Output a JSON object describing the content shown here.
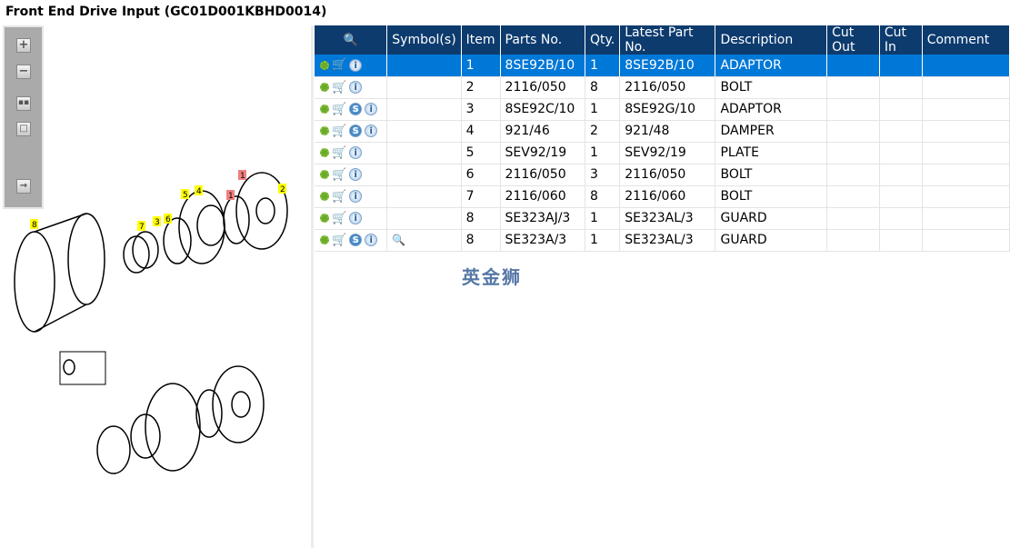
{
  "title": "Front End Drive Input (GC01D001KBHD0014)",
  "watermark": "英金狮",
  "toolbar": [
    "zoom-in",
    "zoom-out",
    "fit-all",
    "fit-window",
    "toggle-panel"
  ],
  "columns": [
    "",
    "Symbol(s)",
    "Item",
    "Parts No.",
    "Qty.",
    "Latest Part No.",
    "Description",
    "Cut Out",
    "Cut In",
    "Comment"
  ],
  "rows": [
    {
      "s": false,
      "sym": false,
      "item": "1",
      "part": "8SE92B/10",
      "qty": "1",
      "latest": "8SE92B/10",
      "desc": "ADAPTOR"
    },
    {
      "s": false,
      "sym": false,
      "item": "2",
      "part": "2116/050",
      "qty": "8",
      "latest": "2116/050",
      "desc": "BOLT"
    },
    {
      "s": true,
      "sym": false,
      "item": "3",
      "part": "8SE92C/10",
      "qty": "1",
      "latest": "8SE92G/10",
      "desc": "ADAPTOR"
    },
    {
      "s": true,
      "sym": false,
      "item": "4",
      "part": "921/46",
      "qty": "2",
      "latest": "921/48",
      "desc": "DAMPER"
    },
    {
      "s": false,
      "sym": false,
      "item": "5",
      "part": "SEV92/19",
      "qty": "1",
      "latest": "SEV92/19",
      "desc": "PLATE"
    },
    {
      "s": false,
      "sym": false,
      "item": "6",
      "part": "2116/050",
      "qty": "3",
      "latest": "2116/050",
      "desc": "BOLT"
    },
    {
      "s": false,
      "sym": false,
      "item": "7",
      "part": "2116/060",
      "qty": "8",
      "latest": "2116/060",
      "desc": "BOLT"
    },
    {
      "s": false,
      "sym": false,
      "item": "8",
      "part": "SE323AJ/3",
      "qty": "1",
      "latest": "SE323AL/3",
      "desc": "GUARD"
    },
    {
      "s": true,
      "sym": true,
      "item": "8",
      "part": "SE323A/3",
      "qty": "1",
      "latest": "SE323AL/3",
      "desc": "GUARD"
    }
  ],
  "callouts": [
    "1",
    "1",
    "2",
    "3",
    "4",
    "5",
    "6",
    "7",
    "8"
  ]
}
